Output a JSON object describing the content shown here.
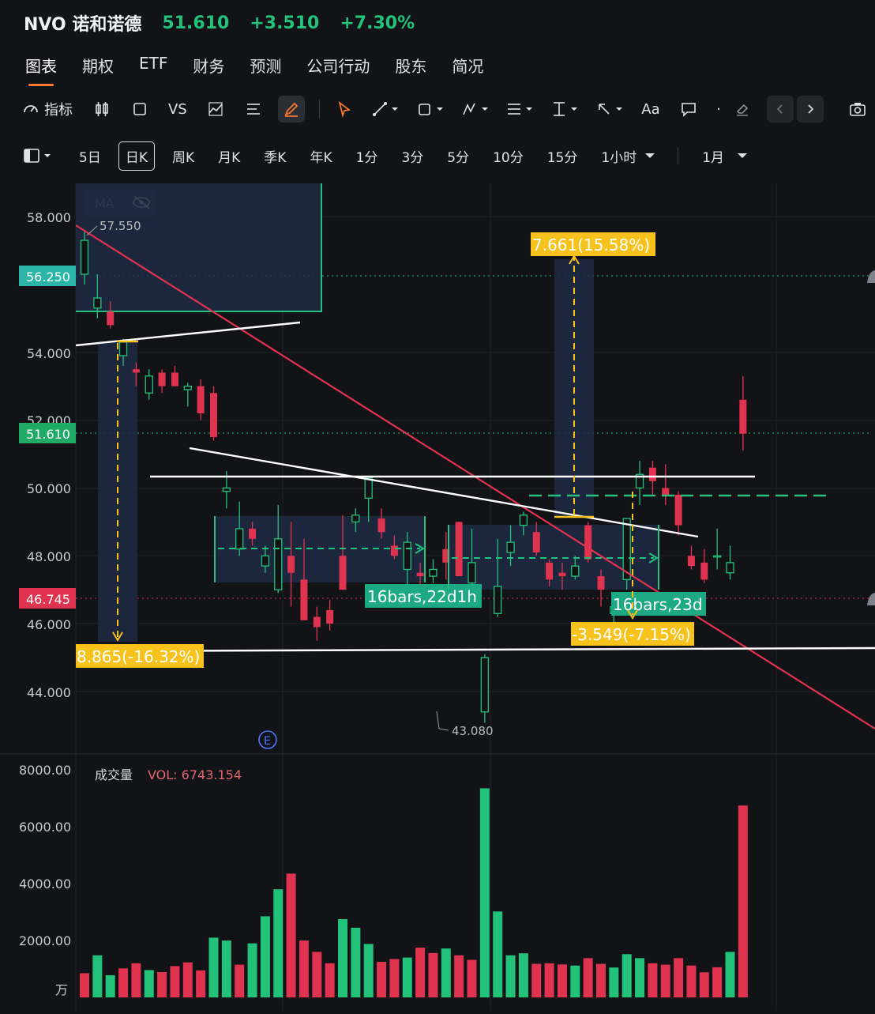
{
  "header": {
    "symbol": "NVO 诺和诺德",
    "last": "51.610",
    "change": "+3.510",
    "change_pct": "+7.30%",
    "colors": {
      "up": "#22c27a",
      "down": "#e0334f"
    }
  },
  "tabs": [
    "图表",
    "期权",
    "ETF",
    "财务",
    "预测",
    "公司行动",
    "股东",
    "简况"
  ],
  "toolbar": {
    "indicator": "指标",
    "vs": "VS",
    "text": "Aa"
  },
  "periods": [
    "5日",
    "日K",
    "周K",
    "月K",
    "季K",
    "年K",
    "1分",
    "3分",
    "5分",
    "10分",
    "15分",
    "1小时",
    "1月"
  ],
  "chart_data": {
    "type": "candlestick",
    "price_axis": {
      "ticks": [
        "58.000",
        "54.000",
        "52.000",
        "50.000",
        "48.000",
        "46.000",
        "44.000"
      ],
      "range": [
        42.5,
        58.7
      ]
    },
    "labels": {
      "ma": "MA",
      "high": "57.550",
      "low": "43.080",
      "e_marker": "E",
      "tag_cyan": "56.250",
      "tag_green": "51.610",
      "tag_red": "46.745"
    },
    "candles": [
      {
        "o": 56.3,
        "h": 57.55,
        "l": 56.0,
        "c": 57.3
      },
      {
        "o": 55.3,
        "h": 56.3,
        "l": 55.0,
        "c": 55.6
      },
      {
        "o": 55.2,
        "h": 55.5,
        "l": 54.7,
        "c": 54.8
      },
      {
        "o": 53.9,
        "h": 54.4,
        "l": 53.6,
        "c": 54.3
      },
      {
        "o": 53.5,
        "h": 53.7,
        "l": 53.0,
        "c": 53.4
      },
      {
        "o": 52.8,
        "h": 53.5,
        "l": 52.6,
        "c": 53.3
      },
      {
        "o": 53.4,
        "h": 53.5,
        "l": 52.8,
        "c": 53.0
      },
      {
        "o": 53.4,
        "h": 53.6,
        "l": 53.0,
        "c": 53.0
      },
      {
        "o": 52.9,
        "h": 53.1,
        "l": 52.4,
        "c": 53.0
      },
      {
        "o": 53.0,
        "h": 53.2,
        "l": 52.0,
        "c": 52.2
      },
      {
        "o": 52.8,
        "h": 53.0,
        "l": 51.4,
        "c": 51.5
      },
      {
        "o": 49.9,
        "h": 50.5,
        "l": 49.4,
        "c": 50.0
      },
      {
        "o": 48.2,
        "h": 49.6,
        "l": 48.0,
        "c": 48.8
      },
      {
        "o": 48.8,
        "h": 49.0,
        "l": 48.3,
        "c": 48.5
      },
      {
        "o": 47.7,
        "h": 48.3,
        "l": 47.5,
        "c": 48.0
      },
      {
        "o": 47.0,
        "h": 49.5,
        "l": 46.9,
        "c": 48.5
      },
      {
        "o": 48.0,
        "h": 49.0,
        "l": 46.5,
        "c": 47.5
      },
      {
        "o": 47.3,
        "h": 48.5,
        "l": 46.2,
        "c": 46.1
      },
      {
        "o": 46.2,
        "h": 46.5,
        "l": 45.5,
        "c": 45.9
      },
      {
        "o": 46.4,
        "h": 46.7,
        "l": 45.8,
        "c": 46.0
      },
      {
        "o": 48.0,
        "h": 49.2,
        "l": 47.0,
        "c": 47.0
      },
      {
        "o": 49.0,
        "h": 49.4,
        "l": 48.7,
        "c": 49.2
      },
      {
        "o": 49.7,
        "h": 50.0,
        "l": 49.0,
        "c": 50.3
      },
      {
        "o": 49.1,
        "h": 49.4,
        "l": 48.5,
        "c": 48.7
      },
      {
        "o": 48.3,
        "h": 48.6,
        "l": 47.9,
        "c": 48.0
      },
      {
        "o": 47.6,
        "h": 48.7,
        "l": 47.1,
        "c": 48.4
      },
      {
        "o": 47.5,
        "h": 47.8,
        "l": 47.0,
        "c": 47.4
      },
      {
        "o": 47.4,
        "h": 47.9,
        "l": 47.2,
        "c": 47.6
      },
      {
        "o": 48.2,
        "h": 48.7,
        "l": 47.3,
        "c": 47.8
      },
      {
        "o": 49.0,
        "h": 49.0,
        "l": 47.4,
        "c": 47.4
      },
      {
        "o": 47.2,
        "h": 48.8,
        "l": 46.9,
        "c": 47.8
      },
      {
        "o": 43.4,
        "h": 45.1,
        "l": 43.08,
        "c": 45.0
      },
      {
        "o": 46.3,
        "h": 48.5,
        "l": 46.2,
        "c": 47.1
      },
      {
        "o": 48.1,
        "h": 48.9,
        "l": 47.7,
        "c": 48.4
      },
      {
        "o": 48.9,
        "h": 49.3,
        "l": 48.6,
        "c": 49.2
      },
      {
        "o": 48.7,
        "h": 49.0,
        "l": 48.0,
        "c": 48.1
      },
      {
        "o": 47.8,
        "h": 47.9,
        "l": 47.1,
        "c": 47.3
      },
      {
        "o": 47.5,
        "h": 47.8,
        "l": 47.0,
        "c": 47.4
      },
      {
        "o": 47.4,
        "h": 48.0,
        "l": 47.3,
        "c": 47.7
      },
      {
        "o": 48.9,
        "h": 49.0,
        "l": 47.8,
        "c": 47.9
      },
      {
        "o": 47.4,
        "h": 47.6,
        "l": 46.5,
        "c": 47.0
      },
      {
        "o": 46.3,
        "h": 46.8,
        "l": 46.0,
        "c": 46.5
      },
      {
        "o": 47.3,
        "h": 49.0,
        "l": 47.0,
        "c": 49.1
      },
      {
        "o": 50.0,
        "h": 50.8,
        "l": 49.5,
        "c": 50.4
      },
      {
        "o": 50.6,
        "h": 50.8,
        "l": 49.8,
        "c": 50.2
      },
      {
        "o": 50.0,
        "h": 50.7,
        "l": 49.5,
        "c": 49.8
      },
      {
        "o": 49.8,
        "h": 49.9,
        "l": 48.6,
        "c": 48.9
      },
      {
        "o": 48.0,
        "h": 48.3,
        "l": 47.6,
        "c": 47.7
      },
      {
        "o": 47.8,
        "h": 48.2,
        "l": 47.2,
        "c": 47.3
      },
      {
        "o": 48.0,
        "h": 48.8,
        "l": 47.6,
        "c": 48.0
      },
      {
        "o": 47.5,
        "h": 48.3,
        "l": 47.3,
        "c": 47.8
      },
      {
        "o": 52.6,
        "h": 53.3,
        "l": 51.1,
        "c": 51.6
      }
    ],
    "drawings": {
      "measure_down_1": "8.865(-16.32%)",
      "measure_up": "7.661(15.58%)",
      "measure_down_2": "-3.549(-7.15%)",
      "range_1": "16bars,22d1h",
      "range_2": "16bars,23d"
    },
    "volume": {
      "title": "成交量",
      "vol_label": "VOL: 6743.154",
      "unit": "万",
      "ticks": [
        "8000.00",
        "6000.00",
        "4000.00",
        "2000.00"
      ],
      "range": [
        0,
        8000
      ],
      "values": [
        850,
        1480,
        780,
        1020,
        1200,
        960,
        890,
        1100,
        1230,
        950,
        2100,
        2000,
        1150,
        1900,
        2850,
        3800,
        4350,
        2000,
        1600,
        1200,
        2750,
        2450,
        1880,
        1250,
        1350,
        1400,
        1750,
        1560,
        1720,
        1480,
        1320,
        7350,
        3020,
        1480,
        1550,
        1180,
        1200,
        1160,
        1120,
        1380,
        1180,
        1050,
        1520,
        1380,
        1200,
        1150,
        1380,
        1120,
        880,
        1060,
        1600,
        6743
      ],
      "up": [
        false,
        true,
        true,
        false,
        false,
        true,
        false,
        false,
        false,
        false,
        true,
        true,
        false,
        true,
        true,
        true,
        false,
        false,
        false,
        false,
        true,
        true,
        true,
        false,
        false,
        true,
        false,
        false,
        true,
        false,
        false,
        true,
        true,
        true,
        true,
        false,
        false,
        false,
        true,
        false,
        false,
        true,
        true,
        true,
        false,
        false,
        false,
        false,
        false,
        false,
        true,
        false
      ]
    }
  }
}
